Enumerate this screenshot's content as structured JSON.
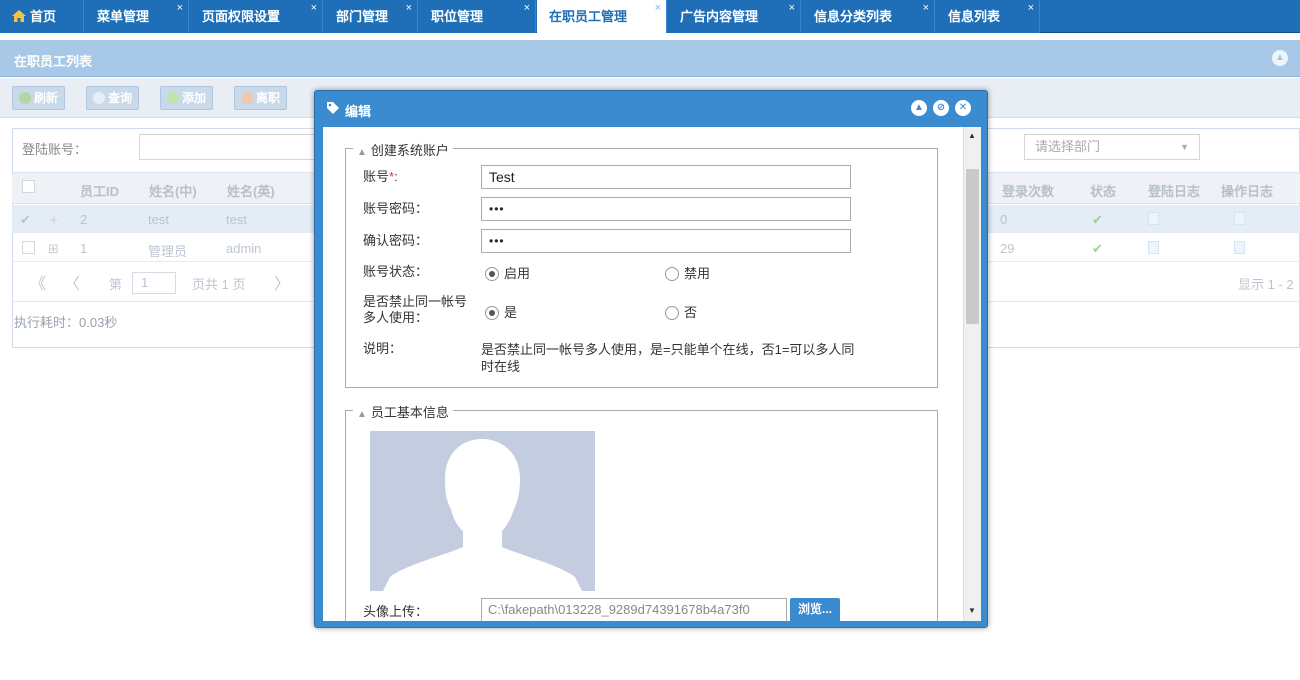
{
  "tabs": [
    {
      "label": "首页",
      "closable": false
    },
    {
      "label": "菜单管理",
      "closable": true
    },
    {
      "label": "页面权限设置",
      "closable": true
    },
    {
      "label": "部门管理",
      "closable": true
    },
    {
      "label": "职位管理",
      "closable": true
    },
    {
      "label": "在职员工管理",
      "closable": true,
      "active": true
    },
    {
      "label": "广告内容管理",
      "closable": true
    },
    {
      "label": "信息分类列表",
      "closable": true
    },
    {
      "label": "信息列表",
      "closable": true
    }
  ],
  "close_glyph": "×",
  "panel": {
    "title": "在职员工列表"
  },
  "toolbar": {
    "refresh": "刷新",
    "query": "查询",
    "add": "添加",
    "leave": "离职"
  },
  "filter": {
    "login_label": "登陆账号：",
    "dept_placeholder": "请选择部门"
  },
  "grid": {
    "headers_left": [
      "员工ID",
      "姓名(中)",
      "姓名(英)"
    ],
    "headers_right": [
      "登录次数",
      "状态",
      "登陆日志",
      "操作日志"
    ],
    "rows": [
      {
        "id": "2",
        "name_cn": "test",
        "name_en": "test",
        "login_count": "0",
        "status": "✔"
      },
      {
        "id": "1",
        "name_cn": "管理员",
        "name_en": "admin",
        "login_count": "29",
        "status": "✔"
      }
    ]
  },
  "pager": {
    "page_prefix": "第",
    "page": "1",
    "page_suffix": "页共 1 页",
    "display": "显示 1 - 2"
  },
  "exec_time": "执行耗时：0.03秒",
  "dialog": {
    "title": "编辑",
    "section1": {
      "legend": "创建系统账户",
      "account_label": "账号",
      "account_value": "Test",
      "password_label": "账号密码：",
      "password_value": "•••",
      "confirm_label": "确认密码：",
      "confirm_value": "•••",
      "status_label": "账号状态：",
      "status_on": "启用",
      "status_off": "禁用",
      "multi_label": "是否禁止同一帐号多人使用：",
      "multi_yes": "是",
      "multi_no": "否",
      "desc_label": "说明：",
      "desc_text": "是否禁止同一帐号多人使用，是=只能单个在线，否1=可以多人同时在线"
    },
    "section2": {
      "legend": "员工基本信息",
      "avatar_label": "头像上传：",
      "avatar_path": "C:\\fakepath\\013228_9289d74391678b4a73f0",
      "browse": "浏览..."
    }
  },
  "colors": {
    "accent": "#3b8bd1",
    "tabbar": "#1e6fb8",
    "panel_header": "#a7c8e6"
  }
}
